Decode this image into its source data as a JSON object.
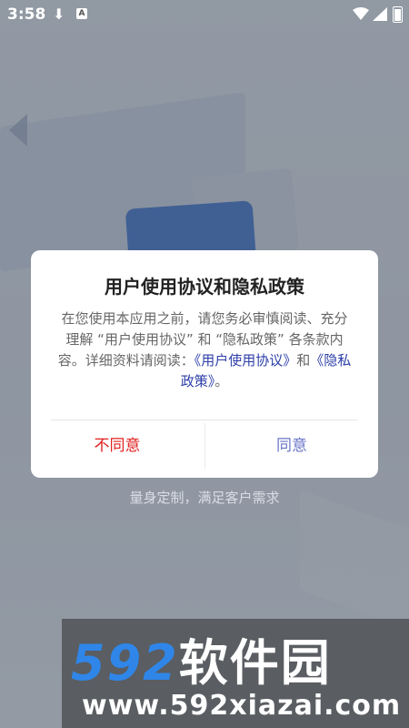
{
  "status_bar": {
    "time": "3:58",
    "download_icon": "download-icon",
    "notification_icon": "app-notification-icon",
    "wifi_icon": "wifi-icon",
    "signal_icon": "signal-icon",
    "battery_icon": "battery-icon"
  },
  "dialog": {
    "title": "用户使用协议和隐私政策",
    "body_prefix": "在您使用本应用之前，请您务必审慎阅读、充分理解 “用户使用协议” 和 “隐私政策” 各条款内容。详细资料请阅读：",
    "link_user_agreement": "《用户使用协议》",
    "conj": "和",
    "link_privacy": "《隐私政策》",
    "body_suffix": "。",
    "disagree_label": "不同意",
    "agree_label": "同意"
  },
  "slogan": "量身定制，满足客户需求",
  "watermark": {
    "brand_number": "592",
    "brand_text": "软件园",
    "url": "www.592xiazai.com"
  },
  "colors": {
    "disagree": "#e02020",
    "agree": "#6a76c8",
    "link": "#2c3ea8",
    "brand_blue": "#2f86e8"
  }
}
